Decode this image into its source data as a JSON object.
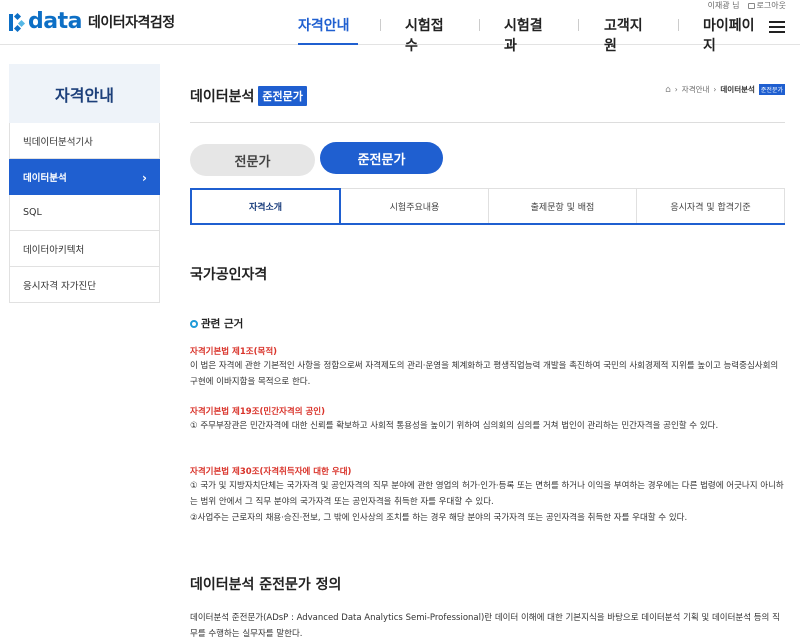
{
  "header": {
    "logo_word": "data",
    "logo_sub": "데이터자격검정",
    "user_text": "이재광 님",
    "logout_label": "로그아웃",
    "nav": [
      {
        "label": "자격안내"
      },
      {
        "label": "시험접수"
      },
      {
        "label": "시험결과"
      },
      {
        "label": "고객지원"
      },
      {
        "label": "마이페이지"
      }
    ]
  },
  "sidebar": {
    "title": "자격안내",
    "items": [
      {
        "label": "빅데이터분석기사"
      },
      {
        "label": "데이터분석"
      },
      {
        "label": "SQL"
      },
      {
        "label": "데이터아키텍처"
      },
      {
        "label": "응시자격 자가진단"
      }
    ]
  },
  "page": {
    "title": "데이터분석",
    "badge": "준전문가",
    "breadcrumb": [
      "자격안내",
      "데이터분석",
      "준전문가"
    ]
  },
  "level_pills": [
    "전문가",
    "준전문가"
  ],
  "tabs": [
    "자격소개",
    "시험주요내용",
    "출제문항 및 배점",
    "응시자격 및 합격기준"
  ],
  "content": {
    "section1_title": "국가공인자격",
    "subsection_title": "관련 근거",
    "laws": [
      {
        "title": "자격기본법 제1조(목적)",
        "body": "이 법은 자격에 관한 기본적인 사항을 정함으로써 자격제도의 관리·운영을 체계화하고 평생직업능력 개발을 촉진하여 국민의 사회경제적 지위를 높이고 능력중심사회의 구현에 이바지함을 목적으로 한다."
      },
      {
        "title": "자격기본법 제19조(민간자격의 공인)",
        "body": "① 주무부장관은 민간자격에 대한 신뢰를 확보하고 사회적 통용성을 높이기 위하여 심의회의 심의를 거쳐 법인이 관리하는 민간자격을 공인할 수 있다."
      },
      {
        "title": "자격기본법 제30조(자격취득자에 대한 우대)",
        "body": "① 국가 및 지방자치단체는 국가자격 및 공인자격의 직무 분야에 관한 영업의 허가·인가·등록 또는 면허를 하거나 이익을 부여하는 경우에는 다른 법령에 어긋나지 아니하는 범위 안에서 그 직무 분야의 국가자격 또는 공인자격을 취득한 자를 우대할 수 있다.",
        "body2": "②사업주는 근로자의 채용·승진·전보, 그 밖에 인사상의 조치를 하는 경우 해당 분야의 국가자격 또는 공인자격을 취득한 자를 우대할 수 있다."
      }
    ],
    "section2_title": "데이터분석 준전문가 정의",
    "definition": "데이터분석 준전문가(ADsP : Advanced Data Analytics Semi-Professional)란 데이터 이해에 대한 기본지식을 바탕으로 데이터분석 기획 및 데이터분석 등의 직무를 수행하는 실무자를 말한다."
  },
  "colors": {
    "brand_blue": "#1f5fd0",
    "logo_blue": "#0d6fc5",
    "law_red": "#d9332a",
    "side_title_bg": "#eef3f9"
  }
}
